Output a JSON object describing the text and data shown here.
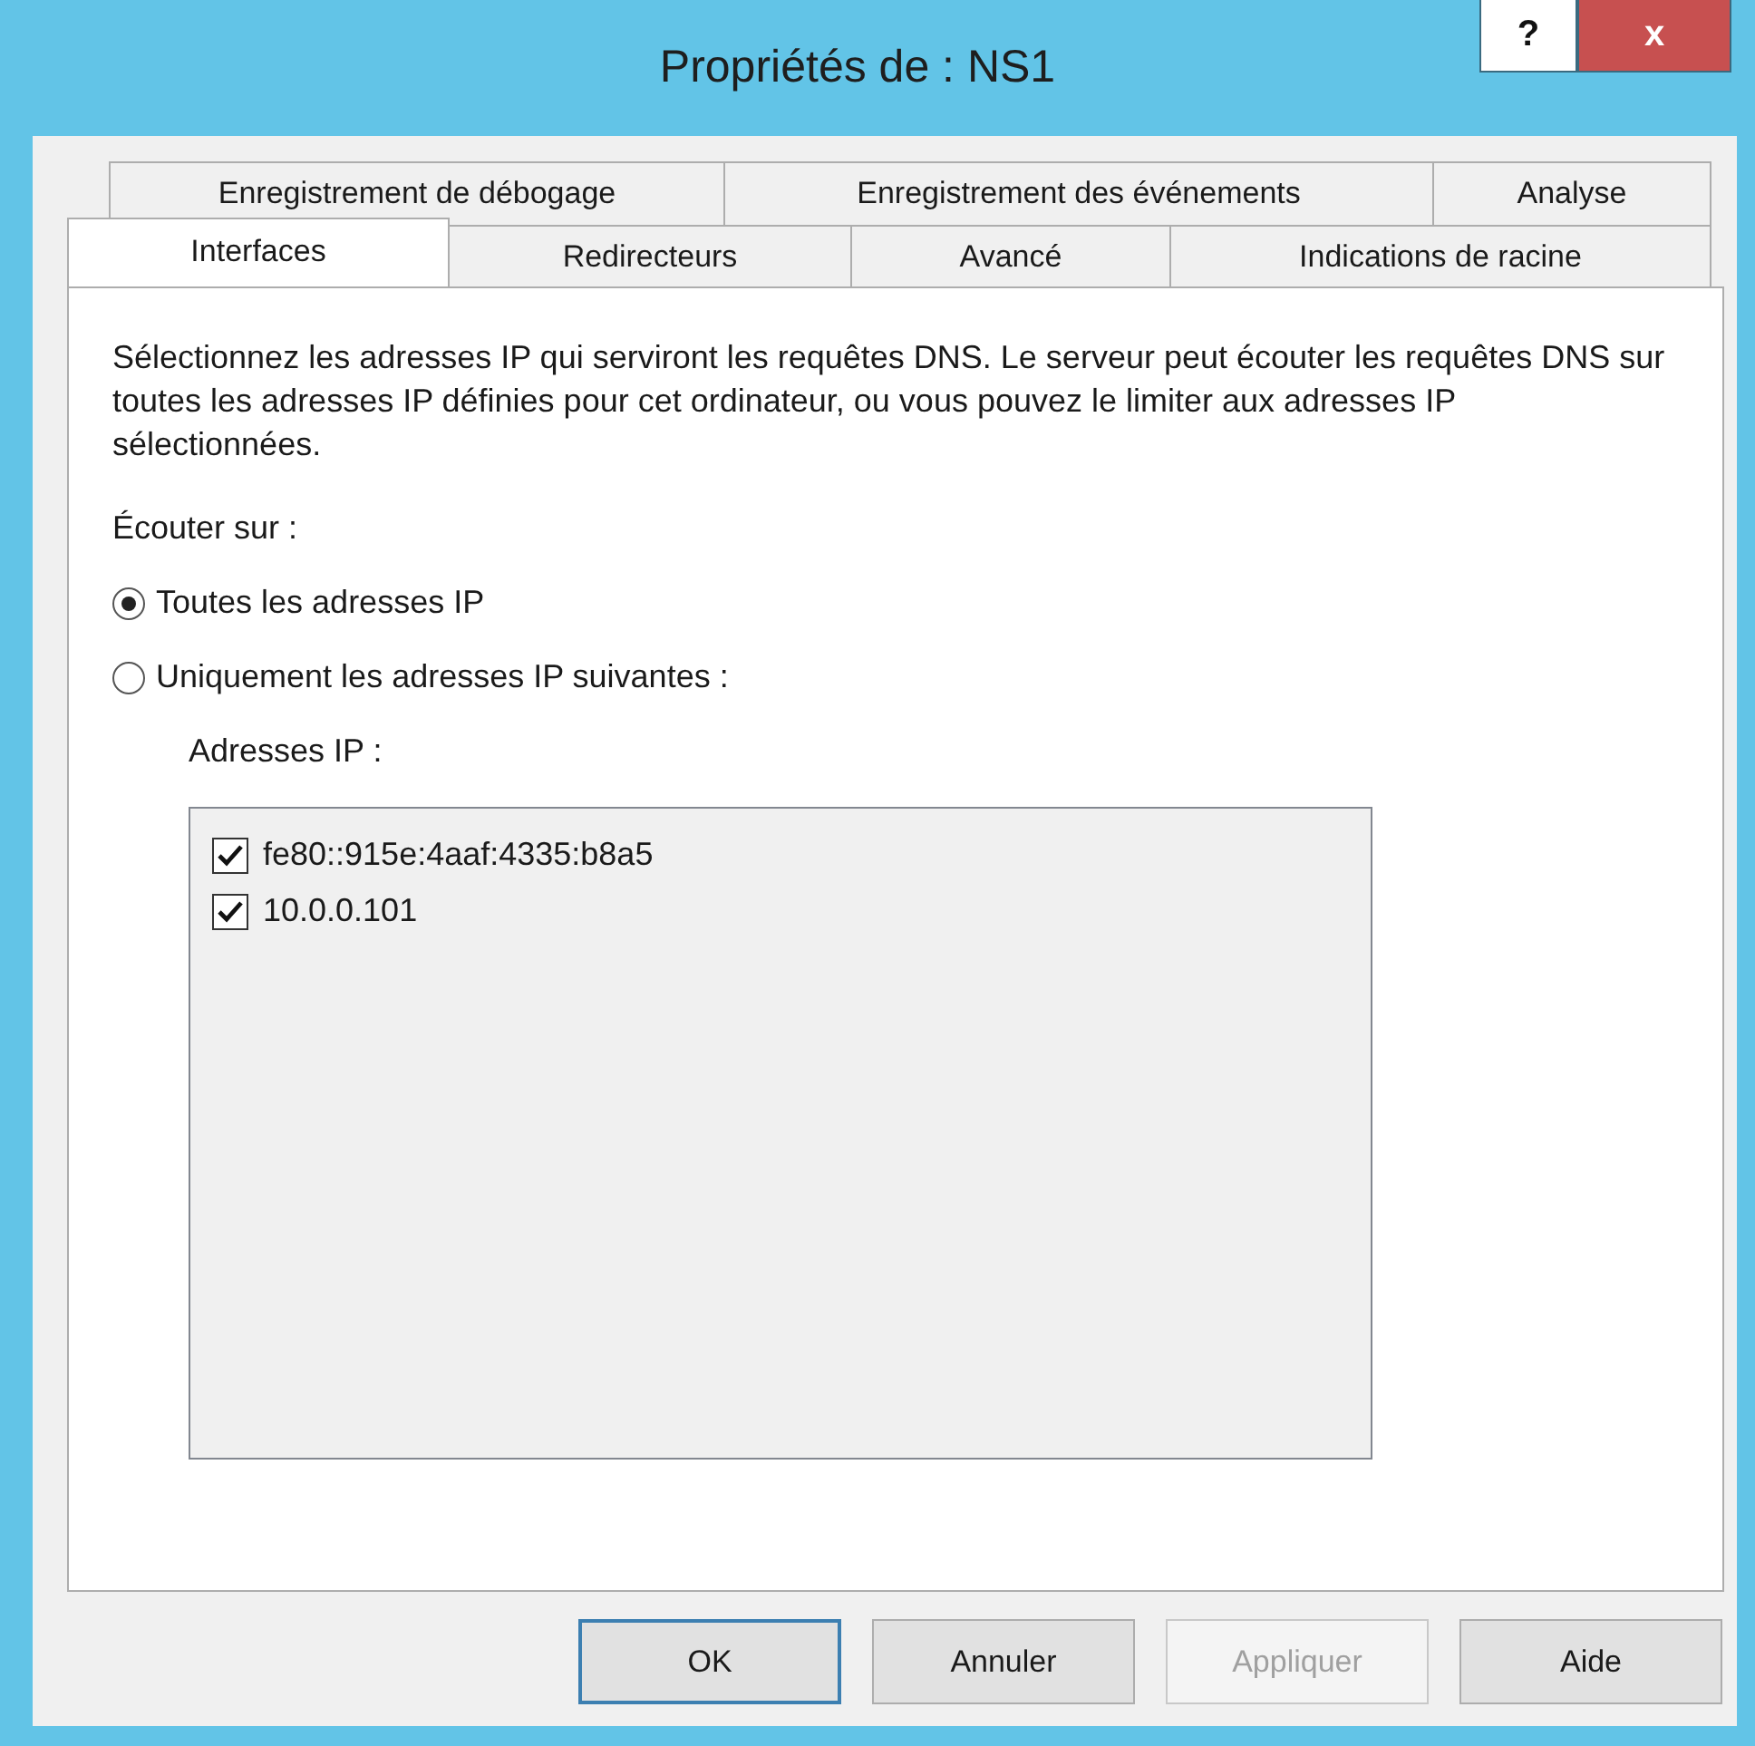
{
  "window": {
    "title": "Propriétés de : NS1",
    "controls": [
      {
        "kind": "help",
        "label": "?"
      },
      {
        "kind": "close",
        "label": "x"
      }
    ]
  },
  "tab_rows": [
    [
      {
        "label": "Enregistrement de débogage",
        "selected": false
      },
      {
        "label": "Enregistrement des événements",
        "selected": false
      },
      {
        "label": "Analyse",
        "selected": false
      }
    ],
    [
      {
        "label": "Interfaces",
        "selected": true
      },
      {
        "label": "Redirecteurs",
        "selected": false
      },
      {
        "label": "Avancé",
        "selected": false
      },
      {
        "label": "Indications de racine",
        "selected": false
      }
    ]
  ],
  "description": "Sélectionnez les adresses IP qui serviront les requêtes DNS. Le serveur peut écouter les requêtes DNS sur toutes les adresses IP définies pour cet ordinateur, ou vous pouvez le limiter aux adresses IP sélectionnées.",
  "listen_label": "Écouter sur :",
  "radios": [
    {
      "label": "Toutes les adresses IP",
      "selected": true
    },
    {
      "label": "Uniquement les adresses IP suivantes :",
      "selected": false
    }
  ],
  "ip_label": "Adresses IP :",
  "ip_list": [
    {
      "address": "fe80::915e:4aaf:4335:b8a5",
      "checked": true
    },
    {
      "address": "10.0.0.101",
      "checked": true
    }
  ],
  "buttons": [
    {
      "label": "OK",
      "disabled": false,
      "default": true
    },
    {
      "label": "Annuler",
      "disabled": false,
      "default": false
    },
    {
      "label": "Appliquer",
      "disabled": true,
      "default": false
    },
    {
      "label": "Aide",
      "disabled": false,
      "default": false
    }
  ]
}
